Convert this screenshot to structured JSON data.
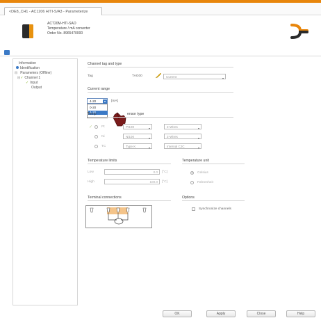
{
  "window": {
    "tab_title": "<DE8_CH1 - AC1206 H/TI-S/A3 - Parameterize"
  },
  "header": {
    "model": "ACT20M-HTI-SAO",
    "description": "Temperature / mA converter",
    "order_no": "Order No. 8965470000",
    "brand_color": "#E8860C"
  },
  "tree": {
    "items": [
      {
        "label": "Information"
      },
      {
        "label": "Identification"
      },
      {
        "label": "Parameters (Offline)"
      },
      {
        "label": "Channel 1"
      },
      {
        "label": "Input"
      },
      {
        "label": "Output"
      }
    ]
  },
  "channel_tag": {
    "section_title": "Channel tag and type",
    "tag_label": "Tag",
    "tag_value": "TAG00",
    "type_value": "Current"
  },
  "current_range": {
    "section_title": "Current range",
    "selected": "4-20",
    "unit": "[mA]",
    "options": [
      "0-20",
      "4-20"
    ]
  },
  "sensor_type": {
    "section_title": "Temperature sensor type",
    "title_left": "Temp",
    "title_right": "ensor type",
    "rows": [
      {
        "label": "Pt",
        "combo1": "Pt100",
        "combo2": "2-Wires"
      },
      {
        "label": "Ni",
        "combo1": "Ni100",
        "combo2": "2-Wires"
      },
      {
        "label": "TC",
        "combo1": "Type K",
        "combo2": "Internal CJC"
      }
    ]
  },
  "temperature_limits": {
    "section_title": "Temperature limits",
    "low_label": "Low",
    "low_value": "0.0",
    "high_label": "High",
    "high_value": "100.0",
    "unit": "[°C]"
  },
  "temperature_unit": {
    "section_title": "Temperature unit",
    "option1": "Celsius",
    "option2": "Fahrenheit"
  },
  "terminal_connections": {
    "section_title": "Terminal connections"
  },
  "options": {
    "section_title": "Options",
    "synchronize_label": "Synchronize channels"
  },
  "buttons": {
    "ok": "OK",
    "apply": "Apply",
    "close": "Close",
    "help": "Help"
  }
}
